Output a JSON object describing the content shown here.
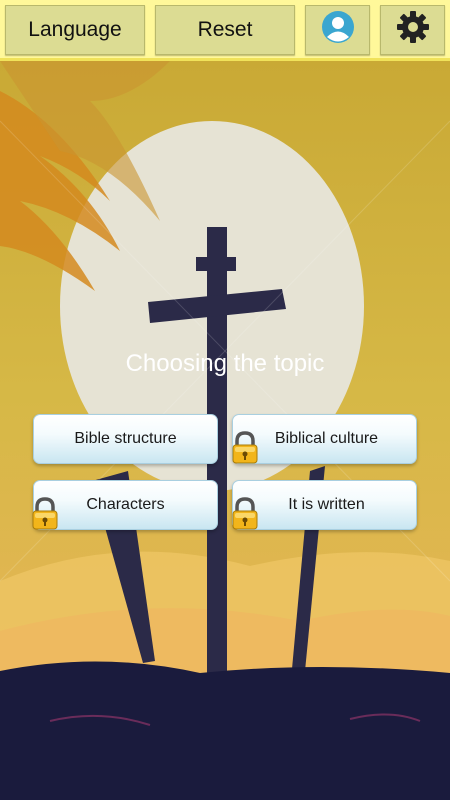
{
  "toolbar": {
    "language_label": "Language",
    "reset_label": "Reset",
    "user_icon": "user-icon",
    "settings_icon": "gear-icon"
  },
  "main": {
    "title": "Choosing the topic",
    "topics": [
      {
        "label": "Bible structure",
        "locked": false
      },
      {
        "label": "Biblical culture",
        "locked": true
      },
      {
        "label": "Characters",
        "locked": true
      },
      {
        "label": "It is written",
        "locked": true
      }
    ]
  },
  "colors": {
    "toolbar_bg": "#fff89a",
    "button_bg": "#dcdc93",
    "user_icon_color": "#3aa6d0",
    "lock_color": "#f2b51a"
  }
}
